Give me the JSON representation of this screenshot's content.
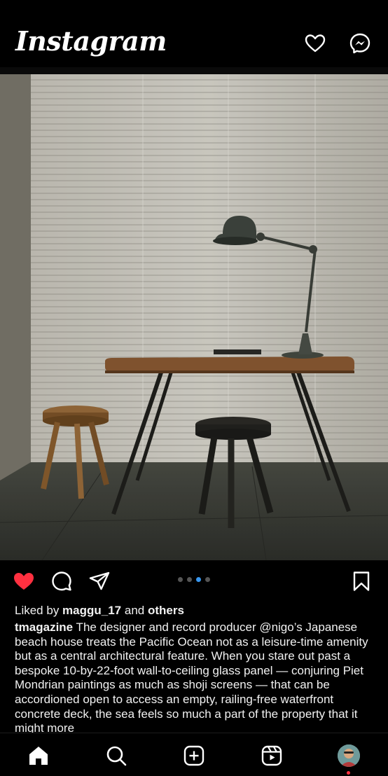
{
  "app": {
    "title": "Instagram"
  },
  "post": {
    "liked_by_prefix": "Liked by ",
    "liked_by_user": "maggu_17",
    "liked_by_mid": " and ",
    "liked_by_others": "others",
    "author": "tmagazine",
    "caption": " The designer and record producer @nigo’s Japanese beach house treats the Pacific Ocean not as a leisure-time amenity but as a central architectural feature. When you stare out past a bespoke 10-by-22-foot wall-to-ceiling glass panel — conjuring Piet Mondrian paintings as much as shoji screens — that can be accordioned open to access an empty, railing-free waterfront concrete deck, the sea feels so much a part of the property that it might more",
    "carousel": {
      "total": 4,
      "active_index": 2
    },
    "liked": true
  },
  "colors": {
    "like_red": "#ff3040",
    "carousel_active": "#3897f0",
    "background": "#000000"
  },
  "nav": {
    "items": [
      "home-icon",
      "search-icon",
      "create-icon",
      "reels-icon",
      "profile-avatar"
    ]
  }
}
